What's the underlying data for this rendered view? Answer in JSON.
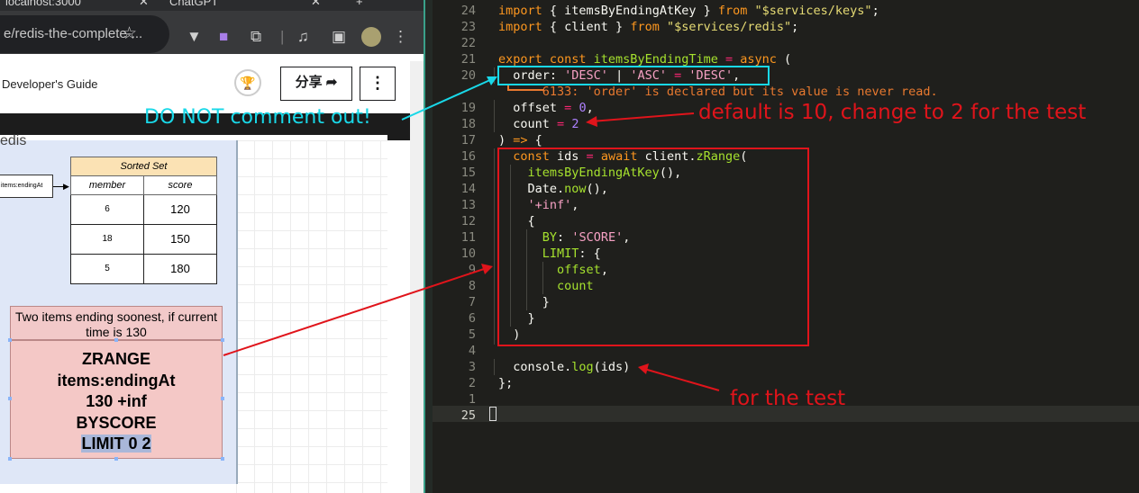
{
  "browser": {
    "tabs": [
      {
        "title": "localhost:3000",
        "close": "✕"
      },
      {
        "title": "ChatGPT",
        "close": "✕"
      }
    ],
    "new_tab": "+",
    "url": "e/redis-the-complete-...",
    "star": "☆",
    "page_title": "Developer's Guide",
    "share_label": "分享 ➦",
    "more_label": "⋮",
    "trophy": "🏆"
  },
  "diagram": {
    "heading": "edis",
    "key_label": "items:endingAt",
    "sorted_set": {
      "title": "Sorted Set",
      "columns": [
        "member",
        "score"
      ],
      "rows": [
        {
          "member": "6",
          "score": "120"
        },
        {
          "member": "18",
          "score": "150"
        },
        {
          "member": "5",
          "score": "180"
        }
      ]
    },
    "note": "Two items ending soonest, if current time is 130",
    "command": [
      "ZRANGE",
      "items:endingAt",
      "130 +inf",
      "BYSCORE",
      "LIMIT 0 2"
    ]
  },
  "editor": {
    "lines": [
      {
        "n": "24",
        "tokens": [
          [
            "kw",
            "import"
          ],
          [
            "txt",
            " { itemsByEndingAtKey } "
          ],
          [
            "kw",
            "from"
          ],
          [
            "txt",
            " "
          ],
          [
            "str",
            "\"$services/keys\""
          ],
          [
            "txt",
            ";"
          ]
        ]
      },
      {
        "n": "23",
        "tokens": [
          [
            "kw",
            "import"
          ],
          [
            "txt",
            " { client } "
          ],
          [
            "kw",
            "from"
          ],
          [
            "txt",
            " "
          ],
          [
            "str",
            "\"$services/redis\""
          ],
          [
            "txt",
            ";"
          ]
        ]
      },
      {
        "n": "22",
        "tokens": []
      },
      {
        "n": "21",
        "tokens": [
          [
            "kw",
            "export const "
          ],
          [
            "fn",
            "itemsByEndingTime"
          ],
          [
            "txt",
            " "
          ],
          [
            "op",
            "="
          ],
          [
            "txt",
            " "
          ],
          [
            "kw",
            "async"
          ],
          [
            "txt",
            " ("
          ]
        ]
      },
      {
        "n": "20",
        "tokens": [
          [
            "txt",
            "  order: "
          ],
          [
            "mag",
            "'DESC'"
          ],
          [
            "txt",
            " | "
          ],
          [
            "mag",
            "'ASC'"
          ],
          [
            "txt",
            " "
          ],
          [
            "op",
            "="
          ],
          [
            "txt",
            " "
          ],
          [
            "mag",
            "'DESC'"
          ],
          [
            "txt",
            ","
          ]
        ]
      },
      {
        "n": "",
        "tokens": [
          [
            "err",
            "      6133: 'order' is declared but its value is never read."
          ]
        ]
      },
      {
        "n": "19",
        "tokens": [
          [
            "txt",
            "  offset "
          ],
          [
            "op",
            "="
          ],
          [
            "txt",
            " "
          ],
          [
            "num",
            "0"
          ],
          [
            "txt",
            ","
          ]
        ]
      },
      {
        "n": "18",
        "tokens": [
          [
            "txt",
            "  count "
          ],
          [
            "op",
            "="
          ],
          [
            "txt",
            " "
          ],
          [
            "num",
            "2"
          ]
        ]
      },
      {
        "n": "17",
        "tokens": [
          [
            "txt",
            ") "
          ],
          [
            "kw",
            "=>"
          ],
          [
            "txt",
            " {"
          ]
        ]
      },
      {
        "n": "16",
        "tokens": [
          [
            "txt",
            "  "
          ],
          [
            "kw",
            "const"
          ],
          [
            "txt",
            " ids "
          ],
          [
            "op",
            "="
          ],
          [
            "txt",
            " "
          ],
          [
            "kw",
            "await"
          ],
          [
            "txt",
            " client."
          ],
          [
            "fn",
            "zRange"
          ],
          [
            "txt",
            "("
          ]
        ]
      },
      {
        "n": "15",
        "tokens": [
          [
            "txt",
            "    "
          ],
          [
            "fn",
            "itemsByEndingAtKey"
          ],
          [
            "txt",
            "(),"
          ]
        ]
      },
      {
        "n": "14",
        "tokens": [
          [
            "txt",
            "    Date."
          ],
          [
            "fn",
            "now"
          ],
          [
            "txt",
            "(),"
          ]
        ]
      },
      {
        "n": "13",
        "tokens": [
          [
            "txt",
            "    "
          ],
          [
            "mag",
            "'+inf'"
          ],
          [
            "txt",
            ","
          ]
        ]
      },
      {
        "n": "12",
        "tokens": [
          [
            "txt",
            "    {"
          ]
        ]
      },
      {
        "n": "11",
        "tokens": [
          [
            "txt",
            "      "
          ],
          [
            "fn",
            "BY"
          ],
          [
            "txt",
            ": "
          ],
          [
            "mag",
            "'SCORE'"
          ],
          [
            "txt",
            ","
          ]
        ]
      },
      {
        "n": "10",
        "tokens": [
          [
            "txt",
            "      "
          ],
          [
            "fn",
            "LIMIT"
          ],
          [
            "txt",
            ": {"
          ]
        ]
      },
      {
        "n": "9",
        "tokens": [
          [
            "txt",
            "        "
          ],
          [
            "fn",
            "offset"
          ],
          [
            "txt",
            ","
          ]
        ]
      },
      {
        "n": "8",
        "tokens": [
          [
            "txt",
            "        "
          ],
          [
            "fn",
            "count"
          ]
        ]
      },
      {
        "n": "7",
        "tokens": [
          [
            "txt",
            "      }"
          ]
        ]
      },
      {
        "n": "6",
        "tokens": [
          [
            "txt",
            "    }"
          ]
        ]
      },
      {
        "n": "5",
        "tokens": [
          [
            "txt",
            "  )"
          ]
        ]
      },
      {
        "n": "4",
        "tokens": []
      },
      {
        "n": "3",
        "tokens": [
          [
            "txt",
            "  console."
          ],
          [
            "fn",
            "log"
          ],
          [
            "txt",
            "(ids)"
          ]
        ]
      },
      {
        "n": "2",
        "tokens": [
          [
            "txt",
            "};"
          ]
        ]
      },
      {
        "n": "1",
        "tokens": []
      },
      {
        "n": "25",
        "tokens": []
      }
    ]
  },
  "annotations": {
    "do_not_comment": "DO NOT comment out!",
    "default_count": "default is 10, change to 2 for the test",
    "for_test": "for the test",
    "cyan": "#19d8e8",
    "red": "#e0141b"
  }
}
